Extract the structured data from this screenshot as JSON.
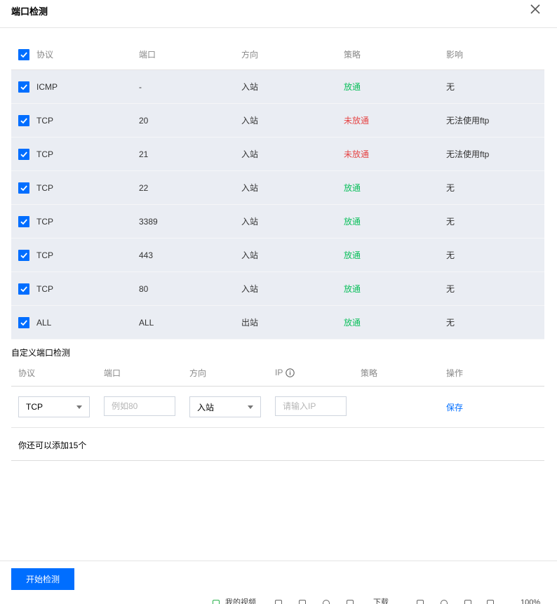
{
  "dialog": {
    "title": "端口检测"
  },
  "table": {
    "headers": {
      "protocol": "协议",
      "port": "端口",
      "direction": "方向",
      "policy": "策略",
      "impact": "影响"
    },
    "rows": [
      {
        "protocol": "ICMP",
        "port": "-",
        "direction": "入站",
        "policy": "放通",
        "policy_status": "pass",
        "impact": "无"
      },
      {
        "protocol": "TCP",
        "port": "20",
        "direction": "入站",
        "policy": "未放通",
        "policy_status": "fail",
        "impact": "无法使用ftp"
      },
      {
        "protocol": "TCP",
        "port": "21",
        "direction": "入站",
        "policy": "未放通",
        "policy_status": "fail",
        "impact": "无法使用ftp"
      },
      {
        "protocol": "TCP",
        "port": "22",
        "direction": "入站",
        "policy": "放通",
        "policy_status": "pass",
        "impact": "无"
      },
      {
        "protocol": "TCP",
        "port": "3389",
        "direction": "入站",
        "policy": "放通",
        "policy_status": "pass",
        "impact": "无"
      },
      {
        "protocol": "TCP",
        "port": "443",
        "direction": "入站",
        "policy": "放通",
        "policy_status": "pass",
        "impact": "无"
      },
      {
        "protocol": "TCP",
        "port": "80",
        "direction": "入站",
        "policy": "放通",
        "policy_status": "pass",
        "impact": "无"
      },
      {
        "protocol": "ALL",
        "port": "ALL",
        "direction": "出站",
        "policy": "放通",
        "policy_status": "pass",
        "impact": "无"
      }
    ]
  },
  "custom": {
    "title": "自定义端口检测",
    "headers": {
      "protocol": "协议",
      "port": "端口",
      "direction": "方向",
      "ip": "IP",
      "policy": "策略",
      "action": "操作"
    },
    "protocol_value": "TCP",
    "port_placeholder": "例如80",
    "direction_value": "入站",
    "ip_placeholder": "请输入IP",
    "save_label": "保存",
    "remaining_text": "你还可以添加15个"
  },
  "footer": {
    "start_label": "开始检测"
  },
  "status_strip": {
    "left_text": "我的视频",
    "download_text": "下载",
    "zoom_text": "100%"
  },
  "colors": {
    "accent": "#006eff",
    "pass": "#0abf5b",
    "fail": "#e54545",
    "row_bg": "#eaedf3"
  }
}
